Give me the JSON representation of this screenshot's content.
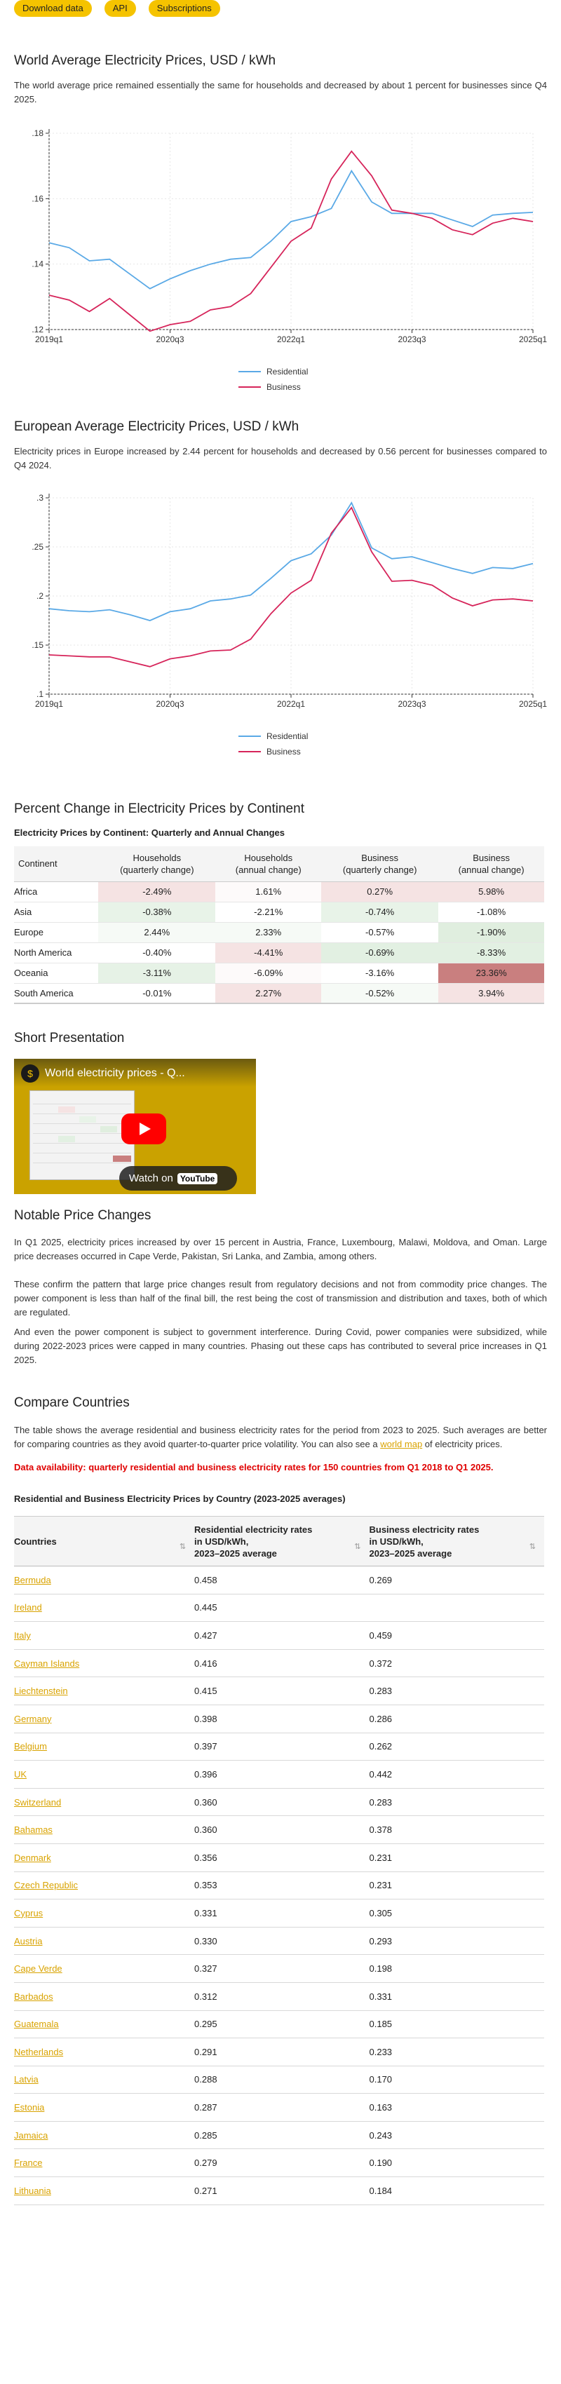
{
  "topbar": {
    "download": "Download data",
    "api": "API",
    "subscriptions": "Subscriptions"
  },
  "world": {
    "title": "World Average Electricity Prices, USD / kWh",
    "text": "The world average price remained essentially the same for households and decreased by about 1 percent for businesses since Q4 2025."
  },
  "europe": {
    "title": "European Average Electricity Prices, USD / kWh",
    "text": "Electricity prices in Europe increased by 2.44 percent for households and decreased by 0.56 percent for businesses compared to Q4 2024."
  },
  "chart_data": [
    {
      "type": "line",
      "x": [
        "2019q1",
        "2019q2",
        "2019q3",
        "2019q4",
        "2020q1",
        "2020q2",
        "2020q3",
        "2020q4",
        "2021q1",
        "2021q2",
        "2021q3",
        "2021q4",
        "2022q1",
        "2022q2",
        "2022q3",
        "2022q4",
        "2023q1",
        "2023q2",
        "2023q3",
        "2023q4",
        "2024q1",
        "2024q2",
        "2024q3",
        "2024q4",
        "2025q1"
      ],
      "xticks": [
        "2019q1",
        "2020q3",
        "2022q1",
        "2023q3",
        "2025q1"
      ],
      "ylim": [
        0.12,
        0.18
      ],
      "yticks": [
        ".12",
        ".14",
        ".16",
        ".18"
      ],
      "grid": true,
      "legend": "bottom",
      "series": [
        {
          "name": "Residential",
          "color": "#5aa9e6",
          "values": [
            0.1465,
            0.145,
            0.141,
            0.1415,
            0.137,
            0.1325,
            0.1355,
            0.138,
            0.14,
            0.1415,
            0.142,
            0.147,
            0.153,
            0.1545,
            0.157,
            0.1685,
            0.159,
            0.1555,
            0.1555,
            0.1555,
            0.1535,
            0.1515,
            0.155,
            0.1555,
            0.1558
          ]
        },
        {
          "name": "Business",
          "color": "#d6245a",
          "values": [
            0.1305,
            0.129,
            0.1255,
            0.1295,
            0.1245,
            0.1195,
            0.1215,
            0.1225,
            0.126,
            0.127,
            0.131,
            0.139,
            0.147,
            0.151,
            0.166,
            0.1745,
            0.167,
            0.1565,
            0.1555,
            0.154,
            0.1505,
            0.149,
            0.1525,
            0.154,
            0.153
          ]
        }
      ]
    },
    {
      "type": "line",
      "x": [
        "2019q1",
        "2019q2",
        "2019q3",
        "2019q4",
        "2020q1",
        "2020q2",
        "2020q3",
        "2020q4",
        "2021q1",
        "2021q2",
        "2021q3",
        "2021q4",
        "2022q1",
        "2022q2",
        "2022q3",
        "2022q4",
        "2023q1",
        "2023q2",
        "2023q3",
        "2023q4",
        "2024q1",
        "2024q2",
        "2024q3",
        "2024q4",
        "2025q1"
      ],
      "xticks": [
        "2019q1",
        "2020q3",
        "2022q1",
        "2023q3",
        "2025q1"
      ],
      "ylim": [
        0.1,
        0.3
      ],
      "yticks": [
        ".1",
        ".15",
        ".2",
        ".25",
        ".3"
      ],
      "grid": true,
      "legend": "bottom",
      "series": [
        {
          "name": "Residential",
          "color": "#5aa9e6",
          "values": [
            0.187,
            0.185,
            0.184,
            0.186,
            0.181,
            0.175,
            0.184,
            0.187,
            0.195,
            0.197,
            0.201,
            0.218,
            0.236,
            0.243,
            0.262,
            0.295,
            0.249,
            0.238,
            0.24,
            0.234,
            0.228,
            0.223,
            0.229,
            0.228,
            0.233
          ]
        },
        {
          "name": "Business",
          "color": "#d6245a",
          "values": [
            0.14,
            0.139,
            0.138,
            0.138,
            0.133,
            0.128,
            0.136,
            0.139,
            0.144,
            0.145,
            0.156,
            0.182,
            0.203,
            0.216,
            0.264,
            0.29,
            0.245,
            0.215,
            0.216,
            0.211,
            0.198,
            0.19,
            0.196,
            0.197,
            0.195
          ]
        }
      ]
    }
  ],
  "continent": {
    "title": "Percent Change in Electricity Prices by Continent",
    "table_title": "Electricity Prices by Continent: Quarterly and Annual Changes",
    "headers": [
      "Continent",
      "Households",
      "(quarterly change)",
      "Households",
      "(annual change)",
      "Business",
      "(quarterly change)",
      "Business",
      "(annual change)"
    ],
    "rows": [
      {
        "name": "Africa",
        "vals": [
          "-2.49%",
          "1.61%",
          "0.27%",
          "5.98%"
        ],
        "bg": [
          "#f5e3e3",
          "#fdfafa",
          "#f5e3e3",
          "#f5e3e3"
        ]
      },
      {
        "name": "Asia",
        "vals": [
          "-0.38%",
          "-2.21%",
          "-0.74%",
          "-1.08%"
        ],
        "bg": [
          "#e8f3e8",
          "#ffffff",
          "#e8f3e8",
          "#ffffff"
        ]
      },
      {
        "name": "Europe",
        "vals": [
          "2.44%",
          "2.33%",
          "-0.57%",
          "-1.90%"
        ],
        "bg": [
          "#f6faf6",
          "#f6faf6",
          "#ffffff",
          "#e0eedf"
        ]
      },
      {
        "name": "North America",
        "vals": [
          "-0.40%",
          "-4.41%",
          "-0.69%",
          "-8.33%"
        ],
        "bg": [
          "#ffffff",
          "#f5e3e3",
          "#e2f0e2",
          "#e2f0e2"
        ]
      },
      {
        "name": "Oceania",
        "vals": [
          "-3.11%",
          "-6.09%",
          "-3.16%",
          "23.36%"
        ],
        "bg": [
          "#e6f2e6",
          "#fdfafa",
          "#ffffff",
          "#c97f7f"
        ]
      },
      {
        "name": "South America",
        "vals": [
          "-0.01%",
          "2.27%",
          "-0.52%",
          "3.94%"
        ],
        "bg": [
          "#ffffff",
          "#f5e3e3",
          "#f6faf6",
          "#f5e3e3"
        ]
      }
    ]
  },
  "presentation": {
    "title": "Short Presentation",
    "video_title": "World electricity prices - Q...",
    "watch": "Watch on",
    "yt": "YouTube"
  },
  "notable": {
    "title": "Notable Price Changes",
    "p1": "In Q1 2025, electricity prices increased by over 15 percent in Austria, France, Luxembourg, Malawi, Moldova, and Oman. Large price decreases occurred in Cape Verde, Pakistan, Sri Lanka, and Zambia, among others.",
    "p2": "These confirm the pattern that large price changes result from regulatory decisions and not from commodity price changes. The power component is less than half of the final bill, the rest being the cost of transmission and distribution and taxes, both of which are regulated.",
    "p3": "And even the power component is subject to government interference. During Covid, power companies were subsidized, while during 2022-2023 prices were capped in many countries. Phasing out these caps has contributed to several price increases in Q1 2025."
  },
  "compare": {
    "title": "Compare Countries",
    "text_before": "The table shows the average residential and business electricity rates for the period from 2023 to 2025. Such averages are better for comparing countries as they avoid quarter-to-quarter price volatility. You can also see a ",
    "link": "world map",
    "text_after": " of electricity prices.",
    "availability": "Data availability: quarterly residential and business electricity rates for 150 countries from Q1 2018 to Q1 2025.",
    "table_title": "Residential and Business Electricity Prices by Country (2023-2025 averages)",
    "headers": {
      "country": "Countries",
      "res1": "Residential electricity rates",
      "res2": "in USD/kWh,",
      "res3": "2023–2025 average",
      "bus1": "Business electricity rates",
      "bus2": "in USD/kWh,",
      "bus3": "2023–2025 average"
    },
    "rows": [
      [
        "Bermuda",
        "0.458",
        "0.269"
      ],
      [
        "Ireland",
        "0.445",
        ""
      ],
      [
        "Italy",
        "0.427",
        "0.459"
      ],
      [
        "Cayman Islands",
        "0.416",
        "0.372"
      ],
      [
        "Liechtenstein",
        "0.415",
        "0.283"
      ],
      [
        "Germany",
        "0.398",
        "0.286"
      ],
      [
        "Belgium",
        "0.397",
        "0.262"
      ],
      [
        "UK",
        "0.396",
        "0.442"
      ],
      [
        "Switzerland",
        "0.360",
        "0.283"
      ],
      [
        "Bahamas",
        "0.360",
        "0.378"
      ],
      [
        "Denmark",
        "0.356",
        "0.231"
      ],
      [
        "Czech Republic",
        "0.353",
        "0.231"
      ],
      [
        "Cyprus",
        "0.331",
        "0.305"
      ],
      [
        "Austria",
        "0.330",
        "0.293"
      ],
      [
        "Cape Verde",
        "0.327",
        "0.198"
      ],
      [
        "Barbados",
        "0.312",
        "0.331"
      ],
      [
        "Guatemala",
        "0.295",
        "0.185"
      ],
      [
        "Netherlands",
        "0.291",
        "0.233"
      ],
      [
        "Latvia",
        "0.288",
        "0.170"
      ],
      [
        "Estonia",
        "0.287",
        "0.163"
      ],
      [
        "Jamaica",
        "0.285",
        "0.243"
      ],
      [
        "France",
        "0.279",
        "0.190"
      ],
      [
        "Lithuania",
        "0.271",
        "0.184"
      ]
    ]
  },
  "icons": {
    "sort": "sort-arrows-icon",
    "play": "play-icon",
    "logo": "channel-logo-icon"
  }
}
